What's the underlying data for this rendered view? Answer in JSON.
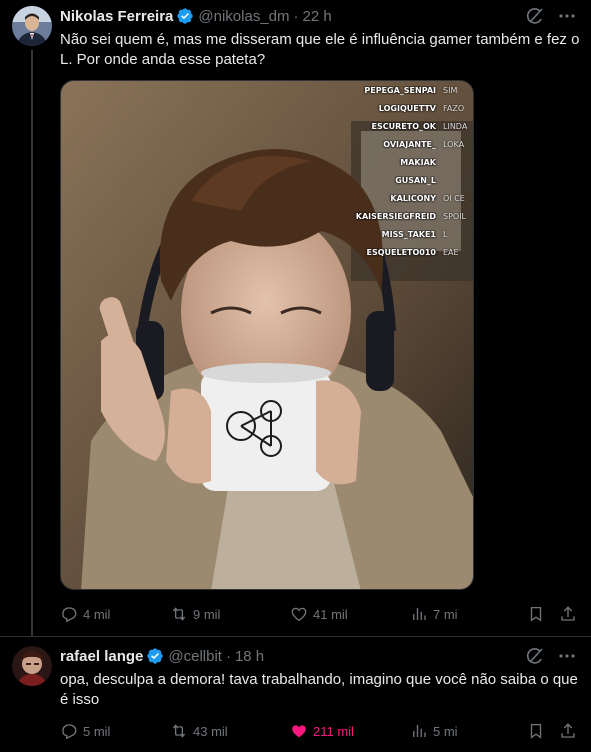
{
  "tweets": [
    {
      "author_name": "Nikolas Ferreira",
      "handle": "@nikolas_dm",
      "separator": "·",
      "time": "22 h",
      "text": "Não sei quem é, mas me disseram que ele é influência gamer também e fez o L. Por onde anda esse pateta?",
      "counts": {
        "replies": "4 mil",
        "reposts": "9 mil",
        "likes": "41 mil",
        "views": "7 mi"
      }
    },
    {
      "author_name": "rafael lange",
      "handle": "@cellbit",
      "separator": "·",
      "time": "18 h",
      "text": "opa, desculpa a demora! tava trabalhando, imagino que você não saiba o que é isso",
      "counts": {
        "replies": "5 mil",
        "reposts": "43 mil",
        "likes": "211 mil",
        "views": "5 mi"
      }
    }
  ],
  "stream_chat": [
    {
      "user": "PEPEGA_SENPAI",
      "msg": "SIM"
    },
    {
      "user": "LOGIQUETTV",
      "msg": "FAZO"
    },
    {
      "user": "ESCURETO_OK",
      "msg": "LINDA"
    },
    {
      "user": "OVIAJANTE_",
      "msg": "LOKA"
    },
    {
      "user": "MAKIAK",
      "msg": ""
    },
    {
      "user": "GUSAN_L",
      "msg": ""
    },
    {
      "user": "KALICONY",
      "msg": "OI CE"
    },
    {
      "user": "KAISERSIEGFREID",
      "msg": "SPOIL"
    },
    {
      "user": "MISS_TAKE1",
      "msg": "L"
    },
    {
      "user": "ESQUELETO010",
      "msg": "EAE"
    }
  ],
  "icons": {
    "verified": "verified-badge-icon",
    "grok": "grok-icon",
    "more": "more-options-icon",
    "reply": "reply-icon",
    "repost": "repost-icon",
    "like": "like-icon",
    "views": "views-icon",
    "bookmark": "bookmark-icon",
    "share": "share-icon"
  },
  "colors": {
    "background": "#000000",
    "text": "#e7e9ea",
    "muted": "#71767b",
    "verified": "#1d9bf0",
    "like_active": "#f91880"
  }
}
